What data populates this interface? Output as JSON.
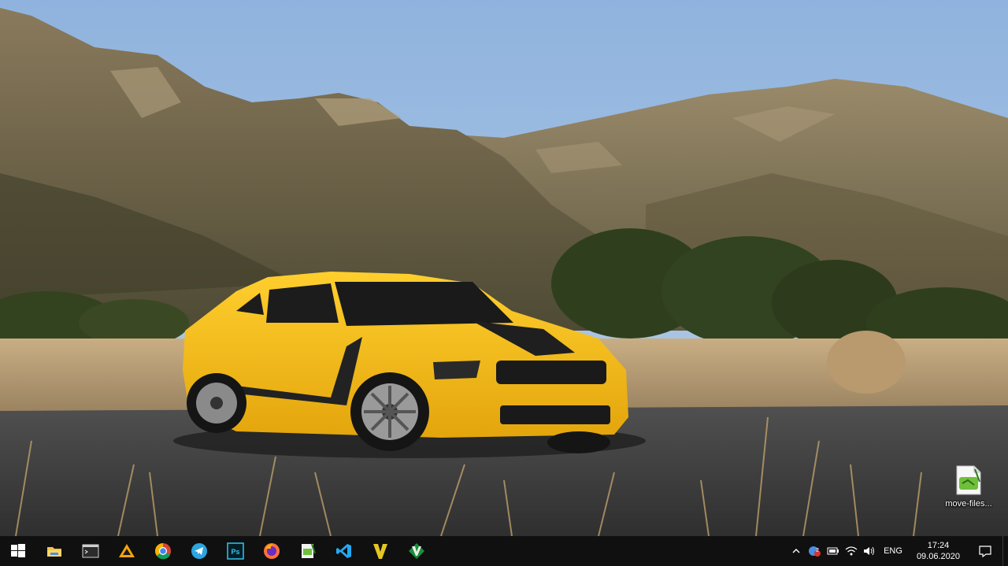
{
  "desktop": {
    "wallpaper": "yellow-sports-car-mountains",
    "icons": [
      {
        "label": "move-files...",
        "icon": "script-file-icon"
      }
    ]
  },
  "taskbar": {
    "background": "#101010",
    "apps": [
      {
        "name": "start",
        "icon": "windows-logo-icon"
      },
      {
        "name": "file-explorer",
        "icon": "folder-icon"
      },
      {
        "name": "terminal",
        "icon": "terminal-icon"
      },
      {
        "name": "app-orange",
        "icon": "orange-triangle-icon"
      },
      {
        "name": "chrome",
        "icon": "chrome-icon"
      },
      {
        "name": "telegram",
        "icon": "telegram-icon"
      },
      {
        "name": "photoshop",
        "icon": "photoshop-icon"
      },
      {
        "name": "firefox",
        "icon": "firefox-icon"
      },
      {
        "name": "notepad",
        "icon": "notepad-icon"
      },
      {
        "name": "vscode",
        "icon": "vscode-icon"
      },
      {
        "name": "vim-editor",
        "icon": "v-icon"
      },
      {
        "name": "gvim",
        "icon": "vim-icon"
      }
    ],
    "tray": {
      "language": "ENG",
      "time": "17:24",
      "date": "09.06.2020",
      "badge": "2"
    }
  }
}
